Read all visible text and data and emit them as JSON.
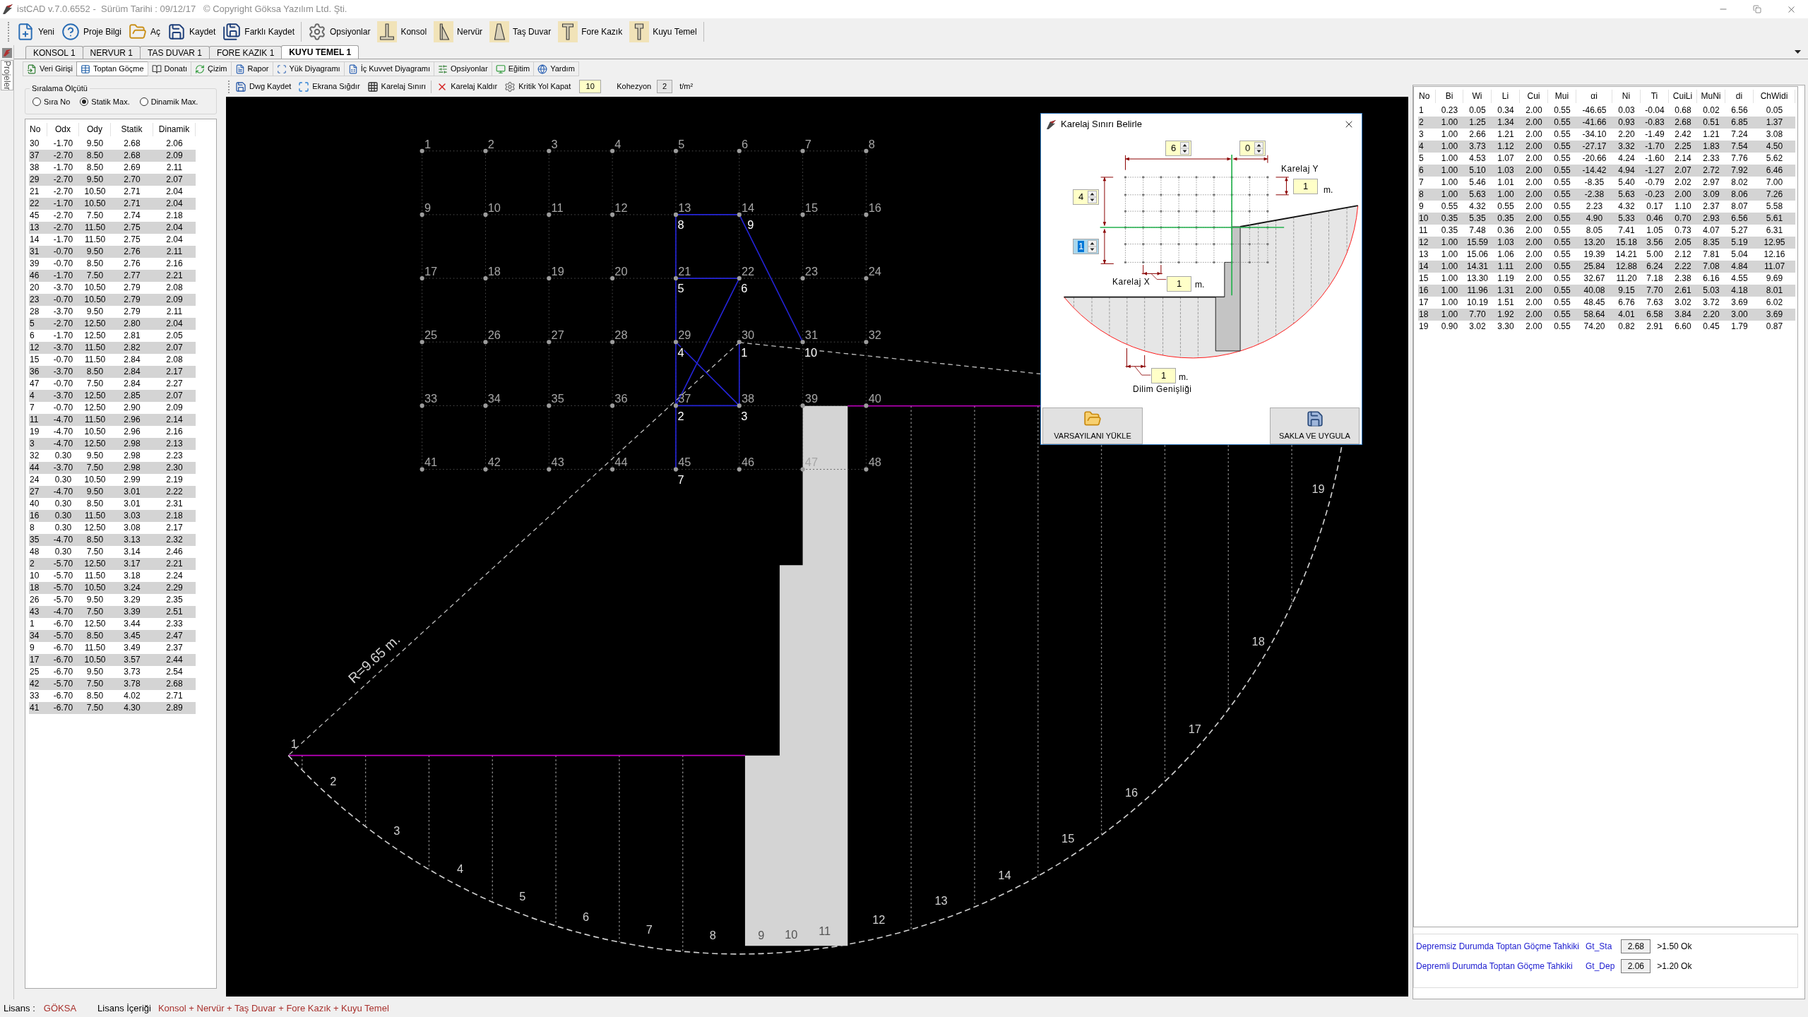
{
  "window": {
    "title": "istCAD v.7.0.6552 -  Sürüm Tarihi : 09/12/17   © Copyright Göksa Yazılım Ltd. Şti."
  },
  "toolbar": {
    "groups": [
      [
        {
          "label": "Yeni",
          "kind": "new"
        },
        {
          "label": "Proje Bilgi",
          "kind": "info"
        },
        {
          "label": "Aç",
          "kind": "open"
        },
        {
          "label": "Kaydet",
          "kind": "save"
        },
        {
          "label": "Farklı Kaydet",
          "kind": "save_as"
        }
      ],
      [
        {
          "label": "Opsiyonlar",
          "kind": "settings"
        },
        {
          "label": "Konsol",
          "kind": "cantilever"
        },
        {
          "label": "Nervür",
          "kind": "buttress"
        },
        {
          "label": "Taş Duvar",
          "kind": "stone_wall"
        },
        {
          "label": "Fore Kazık",
          "kind": "pile"
        },
        {
          "label": "Kuyu Temel",
          "kind": "caisson"
        }
      ]
    ]
  },
  "side_panel": {
    "label": "Projeler"
  },
  "project_tabs": [
    {
      "label": "KONSOL 1",
      "selected": false
    },
    {
      "label": "NERVUR 1",
      "selected": false
    },
    {
      "label": "TAS DUVAR 1",
      "selected": false
    },
    {
      "label": "FORE KAZIK 1",
      "selected": false
    },
    {
      "label": "KUYU TEMEL 1",
      "selected": true
    }
  ],
  "module_tabs": [
    {
      "label": "Veri Girişi",
      "kind": "data_entry",
      "selected": false
    },
    {
      "label": "Toptan Göçme",
      "kind": "stability",
      "selected": true
    },
    {
      "label": "Donatı",
      "kind": "rebar",
      "selected": false
    },
    {
      "label": "Çizim",
      "kind": "drawing",
      "selected": false
    },
    {
      "label": "Rapor",
      "kind": "report",
      "selected": false
    },
    {
      "label": "Yük Diyagramı",
      "kind": "load_diagram",
      "selected": false
    },
    {
      "label": "İç Kuvvet Diyagramı",
      "kind": "force_diagram",
      "selected": false
    },
    {
      "label": "Opsiyonlar",
      "kind": "options",
      "selected": false
    },
    {
      "label": "Eğitim",
      "kind": "training",
      "selected": false
    },
    {
      "label": "Yardım",
      "kind": "help",
      "selected": false
    }
  ],
  "sort_panel": {
    "title": "Sıralama Ölçütü",
    "options": [
      {
        "label": "Sıra No",
        "selected": false
      },
      {
        "label": "Statik Max.",
        "selected": true
      },
      {
        "label": "Dinamik Max.",
        "selected": false
      }
    ]
  },
  "points_table": {
    "columns": [
      "No",
      "Odx",
      "Ody",
      "Statik",
      "Dinamik"
    ],
    "rows": [
      [
        "30",
        "-1.70",
        "9.50",
        "2.68",
        "2.06"
      ],
      [
        "37",
        "-2.70",
        "8.50",
        "2.68",
        "2.09"
      ],
      [
        "38",
        "-1.70",
        "8.50",
        "2.69",
        "2.11"
      ],
      [
        "29",
        "-2.70",
        "9.50",
        "2.70",
        "2.07"
      ],
      [
        "21",
        "-2.70",
        "10.50",
        "2.71",
        "2.04"
      ],
      [
        "22",
        "-1.70",
        "10.50",
        "2.71",
        "2.04"
      ],
      [
        "45",
        "-2.70",
        "7.50",
        "2.74",
        "2.18"
      ],
      [
        "13",
        "-2.70",
        "11.50",
        "2.75",
        "2.04"
      ],
      [
        "14",
        "-1.70",
        "11.50",
        "2.75",
        "2.04"
      ],
      [
        "31",
        "-0.70",
        "9.50",
        "2.76",
        "2.11"
      ],
      [
        "39",
        "-0.70",
        "8.50",
        "2.76",
        "2.16"
      ],
      [
        "46",
        "-1.70",
        "7.50",
        "2.77",
        "2.21"
      ],
      [
        "20",
        "-3.70",
        "10.50",
        "2.79",
        "2.08"
      ],
      [
        "23",
        "-0.70",
        "10.50",
        "2.79",
        "2.09"
      ],
      [
        "28",
        "-3.70",
        "9.50",
        "2.79",
        "2.11"
      ],
      [
        "5",
        "-2.70",
        "12.50",
        "2.80",
        "2.04"
      ],
      [
        "6",
        "-1.70",
        "12.50",
        "2.81",
        "2.05"
      ],
      [
        "12",
        "-3.70",
        "11.50",
        "2.82",
        "2.07"
      ],
      [
        "15",
        "-0.70",
        "11.50",
        "2.84",
        "2.08"
      ],
      [
        "36",
        "-3.70",
        "8.50",
        "2.84",
        "2.17"
      ],
      [
        "47",
        "-0.70",
        "7.50",
        "2.84",
        "2.27"
      ],
      [
        "4",
        "-3.70",
        "12.50",
        "2.85",
        "2.07"
      ],
      [
        "7",
        "-0.70",
        "12.50",
        "2.90",
        "2.09"
      ],
      [
        "11",
        "-4.70",
        "11.50",
        "2.96",
        "2.14"
      ],
      [
        "19",
        "-4.70",
        "10.50",
        "2.96",
        "2.16"
      ],
      [
        "3",
        "-4.70",
        "12.50",
        "2.98",
        "2.13"
      ],
      [
        "32",
        "0.30",
        "9.50",
        "2.98",
        "2.23"
      ],
      [
        "44",
        "-3.70",
        "7.50",
        "2.98",
        "2.30"
      ],
      [
        "24",
        "0.30",
        "10.50",
        "2.99",
        "2.19"
      ],
      [
        "27",
        "-4.70",
        "9.50",
        "3.01",
        "2.22"
      ],
      [
        "40",
        "0.30",
        "8.50",
        "3.01",
        "2.31"
      ],
      [
        "16",
        "0.30",
        "11.50",
        "3.03",
        "2.18"
      ],
      [
        "8",
        "0.30",
        "12.50",
        "3.08",
        "2.17"
      ],
      [
        "35",
        "-4.70",
        "8.50",
        "3.13",
        "2.32"
      ],
      [
        "48",
        "0.30",
        "7.50",
        "3.14",
        "2.46"
      ],
      [
        "2",
        "-5.70",
        "12.50",
        "3.17",
        "2.21"
      ],
      [
        "10",
        "-5.70",
        "11.50",
        "3.18",
        "2.24"
      ],
      [
        "18",
        "-5.70",
        "10.50",
        "3.24",
        "2.29"
      ],
      [
        "26",
        "-5.70",
        "9.50",
        "3.29",
        "2.35"
      ],
      [
        "43",
        "-4.70",
        "7.50",
        "3.39",
        "2.51"
      ],
      [
        "1",
        "-6.70",
        "12.50",
        "3.44",
        "2.33"
      ],
      [
        "34",
        "-5.70",
        "8.50",
        "3.45",
        "2.47"
      ],
      [
        "9",
        "-6.70",
        "11.50",
        "3.49",
        "2.37"
      ],
      [
        "17",
        "-6.70",
        "10.50",
        "3.57",
        "2.44"
      ],
      [
        "25",
        "-6.70",
        "9.50",
        "3.73",
        "2.54"
      ],
      [
        "42",
        "-5.70",
        "7.50",
        "3.78",
        "2.68"
      ],
      [
        "33",
        "-6.70",
        "8.50",
        "4.02",
        "2.71"
      ],
      [
        "41",
        "-6.70",
        "7.50",
        "4.30",
        "2.89"
      ]
    ]
  },
  "canvas_toolbar": {
    "button_groups": [
      [
        {
          "label": "Dwg Kaydet",
          "kind": "save"
        },
        {
          "label": "Ekrana Sığdır",
          "kind": "fit"
        },
        {
          "label": "Karelaj Sınırı",
          "kind": "grid"
        }
      ],
      [
        {
          "label": "Karelaj Kaldır",
          "kind": "remove"
        },
        {
          "label": "Kritik Yol Kapat",
          "kind": "gear"
        }
      ]
    ],
    "value_field": "10",
    "cohesion": {
      "label": "Kohezyon",
      "value": "2",
      "unit": "t/m²"
    }
  },
  "canvas": {
    "grid_points": [
      "1",
      "2",
      "3",
      "4",
      "5",
      "6",
      "7",
      "8",
      "9",
      "10",
      "11",
      "12",
      "13",
      "14",
      "15",
      "16",
      "17",
      "18",
      "19",
      "20",
      "21",
      "22",
      "23",
      "24",
      "25",
      "26",
      "27",
      "28",
      "29",
      "30",
      "31",
      "32",
      "33",
      "34",
      "35",
      "36",
      "37",
      "38",
      "39",
      "40",
      "41",
      "42",
      "43",
      "44",
      "45",
      "46",
      "47",
      "48"
    ],
    "path_nodes": [
      "8",
      "9",
      "5",
      "6",
      "4",
      "1",
      "10",
      "2",
      "3",
      "7"
    ],
    "radius_label": "R=9.65 m.",
    "slices": [
      "1",
      "2",
      "3",
      "4",
      "5",
      "6",
      "7",
      "8",
      "9",
      "10",
      "11",
      "12",
      "13",
      "14",
      "15",
      "16",
      "17",
      "18",
      "19"
    ]
  },
  "dialog": {
    "title": "Karelaj Sınırı Belirle",
    "spinners": [
      {
        "value": "6",
        "focused": false
      },
      {
        "value": "0",
        "focused": false
      },
      {
        "value": "4",
        "focused": false
      },
      {
        "value": "1",
        "focused": true
      }
    ],
    "fields": [
      {
        "label": "Karelaj Y",
        "value": "1",
        "unit": "m."
      },
      {
        "label": "Karelaj X",
        "value": "1",
        "unit": "m."
      },
      {
        "label": "Dilim Genişliği",
        "value": "1",
        "unit": "m."
      }
    ],
    "buttons": [
      {
        "label": "VARSAYILANI YÜKLE",
        "kind": "load"
      },
      {
        "label": "SAKLA VE UYGULA",
        "kind": "save"
      }
    ]
  },
  "slices_table": {
    "columns": [
      "No",
      "Bi",
      "Wi",
      "Li",
      "Cui",
      "Mui",
      "αi",
      "Ni",
      "Ti",
      "CuiLi",
      "MuNi",
      "di",
      "ChWidi"
    ],
    "rows": [
      [
        "1",
        "0.23",
        "0.05",
        "0.34",
        "2.00",
        "0.55",
        "-46.65",
        "0.03",
        "-0.04",
        "0.68",
        "0.02",
        "6.56",
        "0.05"
      ],
      [
        "2",
        "1.00",
        "1.25",
        "1.34",
        "2.00",
        "0.55",
        "-41.66",
        "0.93",
        "-0.83",
        "2.68",
        "0.51",
        "6.85",
        "1.37"
      ],
      [
        "3",
        "1.00",
        "2.66",
        "1.21",
        "2.00",
        "0.55",
        "-34.10",
        "2.20",
        "-1.49",
        "2.42",
        "1.21",
        "7.24",
        "3.08"
      ],
      [
        "4",
        "1.00",
        "3.73",
        "1.12",
        "2.00",
        "0.55",
        "-27.17",
        "3.32",
        "-1.70",
        "2.25",
        "1.83",
        "7.54",
        "4.50"
      ],
      [
        "5",
        "1.00",
        "4.53",
        "1.07",
        "2.00",
        "0.55",
        "-20.66",
        "4.24",
        "-1.60",
        "2.14",
        "2.33",
        "7.76",
        "5.62"
      ],
      [
        "6",
        "1.00",
        "5.10",
        "1.03",
        "2.00",
        "0.55",
        "-14.42",
        "4.94",
        "-1.27",
        "2.07",
        "2.72",
        "7.92",
        "6.46"
      ],
      [
        "7",
        "1.00",
        "5.46",
        "1.01",
        "2.00",
        "0.55",
        "-8.35",
        "5.40",
        "-0.79",
        "2.02",
        "2.97",
        "8.02",
        "7.00"
      ],
      [
        "8",
        "1.00",
        "5.63",
        "1.00",
        "2.00",
        "0.55",
        "-2.38",
        "5.63",
        "-0.23",
        "2.00",
        "3.09",
        "8.06",
        "7.26"
      ],
      [
        "9",
        "0.55",
        "4.32",
        "0.55",
        "2.00",
        "0.55",
        "2.23",
        "4.32",
        "0.17",
        "1.10",
        "2.37",
        "8.07",
        "5.58"
      ],
      [
        "10",
        "0.35",
        "5.35",
        "0.35",
        "2.00",
        "0.55",
        "4.90",
        "5.33",
        "0.46",
        "0.70",
        "2.93",
        "6.56",
        "5.61"
      ],
      [
        "11",
        "0.35",
        "7.48",
        "0.36",
        "2.00",
        "0.55",
        "8.05",
        "7.41",
        "1.05",
        "0.73",
        "4.07",
        "5.27",
        "6.31"
      ],
      [
        "12",
        "1.00",
        "15.59",
        "1.03",
        "2.00",
        "0.55",
        "13.20",
        "15.18",
        "3.56",
        "2.05",
        "8.35",
        "5.19",
        "12.95"
      ],
      [
        "13",
        "1.00",
        "15.06",
        "1.06",
        "2.00",
        "0.55",
        "19.39",
        "14.21",
        "5.00",
        "2.12",
        "7.81",
        "5.04",
        "12.16"
      ],
      [
        "14",
        "1.00",
        "14.31",
        "1.11",
        "2.00",
        "0.55",
        "25.84",
        "12.88",
        "6.24",
        "2.22",
        "7.08",
        "4.84",
        "11.07"
      ],
      [
        "15",
        "1.00",
        "13.30",
        "1.19",
        "2.00",
        "0.55",
        "32.67",
        "11.20",
        "7.18",
        "2.38",
        "6.16",
        "4.55",
        "9.69"
      ],
      [
        "16",
        "1.00",
        "11.96",
        "1.31",
        "2.00",
        "0.55",
        "40.08",
        "9.15",
        "7.70",
        "2.61",
        "5.03",
        "4.18",
        "8.01"
      ],
      [
        "17",
        "1.00",
        "10.19",
        "1.51",
        "2.00",
        "0.55",
        "48.45",
        "6.76",
        "7.63",
        "3.02",
        "3.72",
        "3.69",
        "6.02"
      ],
      [
        "18",
        "1.00",
        "7.70",
        "1.92",
        "2.00",
        "0.55",
        "58.64",
        "4.01",
        "6.58",
        "3.84",
        "2.20",
        "3.00",
        "3.69"
      ],
      [
        "19",
        "0.90",
        "3.02",
        "3.30",
        "2.00",
        "0.55",
        "74.20",
        "0.82",
        "2.91",
        "6.60",
        "0.45",
        "1.79",
        "0.87"
      ]
    ]
  },
  "results": [
    {
      "label": "Depremsiz Durumda Toptan Göçme Tahkiki",
      "symbol": "Gt_Sta",
      "value": "2.68",
      "criterion": ">1.50 Ok"
    },
    {
      "label": "Depremli Durumda Toptan Göçme Tahkiki",
      "symbol": "Gt_Dep",
      "value": "2.06",
      "criterion": ">1.20 Ok"
    }
  ],
  "status_bar": {
    "license_label": "Lisans :",
    "license": "GÖKSA",
    "content_label": "Lisans İçeriği",
    "content": "Konsol + Nervür + Taş Duvar + Fore Kazık + Kuyu Temel"
  }
}
